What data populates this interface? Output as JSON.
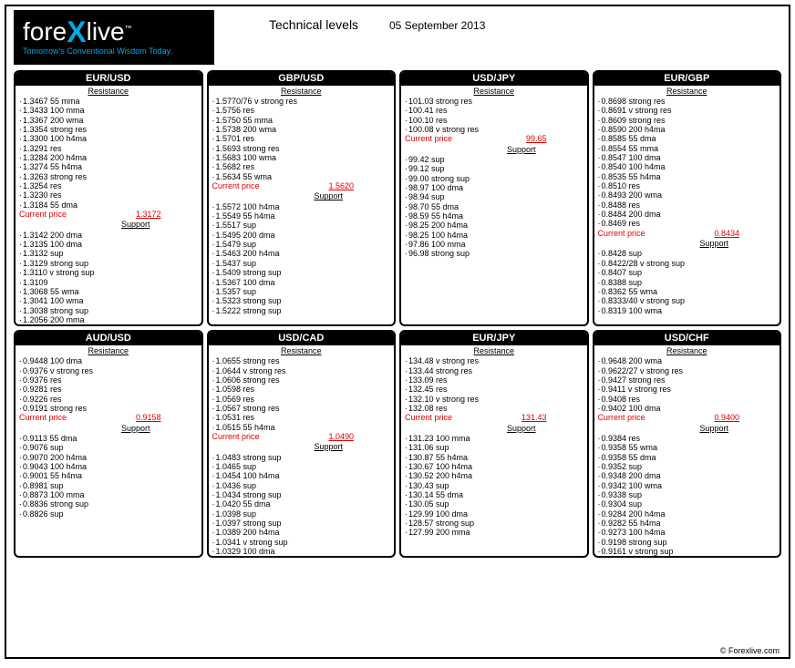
{
  "brand": {
    "name_pre": "fore",
    "name_x": "X",
    "name_post": "live",
    "tm": "™",
    "tagline": "Tomorrow's Conventional Wisdom Today."
  },
  "header": {
    "title": "Technical levels",
    "date": "05 September 2013"
  },
  "labels": {
    "resistance": "Resistance",
    "support": "Support",
    "current_price": "Current price"
  },
  "footer": "© Forexlive.com",
  "pairs": [
    {
      "symbol": "EUR/USD",
      "resistance": [
        "1.3467 55 mma",
        "1.3433 100 mma",
        "1.3367 200 wma",
        "1.3354 strong res",
        "1.3300 100 h4ma",
        "1.3291 res",
        "1.3284 200 h4ma",
        "1.3274 55 h4ma",
        "1.3263 strong res",
        "1.3254 res",
        "1.3230 res",
        "1.3184 55 dma"
      ],
      "current_price": "1.3172",
      "support": [
        "1.3142 200 dma",
        "1.3135 100 dma",
        "1.3132 sup",
        "1.3129 strong sup",
        "1.3110 v strong sup",
        "1.3109",
        "1.3068 55 wma",
        "1.3041 100 wma",
        "1.3038 strong sup",
        "1.2056 200 mma"
      ]
    },
    {
      "symbol": "GBP/USD",
      "resistance": [
        "1.5770/76 v strong res",
        "1.5756 res",
        "1.5750 55 mma",
        "1.5738 200 wma",
        "1.5701 res",
        "1.5693 strong res",
        "1.5683 100 wma",
        "1.5682 res",
        "1.5634 55 wma"
      ],
      "current_price": "1.5620",
      "support": [
        "1.5572 100 h4ma",
        "1.5549 55 h4ma",
        "1.5517 sup",
        "1.5495 200 dma",
        "1.5479 sup",
        "1.5463 200 h4ma",
        "1.5437 sup",
        "1.5409 strong sup",
        "1.5367 100 dma",
        "1.5357 sup",
        "1.5323 strong sup",
        "1.5222 strong sup"
      ]
    },
    {
      "symbol": "USD/JPY",
      "resistance": [
        "101.03 strong res",
        "100.41 res",
        "100.10 res",
        "100.08 v strong res"
      ],
      "current_price": "99.65",
      "support": [
        "99.42 sup",
        "99.12 sup",
        "99.00 strong sup",
        "98.97 100 dma",
        "98.94 sup",
        "98.70 55 dma",
        "98.59 55 h4ma",
        "98.25 200 h4ma",
        "98.25 100 h4ma",
        "97.86 100 mma",
        "96.98 strong sup"
      ]
    },
    {
      "symbol": "EUR/GBP",
      "resistance": [
        "0.8698 strong res",
        "0.8691 v strong res",
        "0.8609 strong res",
        "0.8590 200 h4ma",
        "0.8585 55 dma",
        "0.8554 55 mma",
        "0.8547 100 dma",
        "0.8540 100 h4ma",
        "0.8535 55 h4ma",
        "0.8510 res",
        "0.8493 200 wma",
        "0.8488 res",
        "0.8484 200 dma",
        "0.8469 res"
      ],
      "current_price": "0.8434",
      "support": [
        "0.8428 sup",
        "0.8422/28 v strong sup",
        "0.8407 sup",
        "0.8388 sup",
        "0.8362 55 wma",
        "0.8333/40 v strong sup",
        "0.8319 100 wma"
      ]
    },
    {
      "symbol": "AUD/USD",
      "resistance": [
        "0.9448 100 dma",
        "0.9376 v strong res",
        "0.9376 res",
        "0.9281 res",
        "0.9226 res",
        "0.9191 strong res"
      ],
      "current_price": "0.9158",
      "support": [
        "0.9113 55 dma",
        "0.9076 sup",
        "0.9070 200 h4ma",
        "0.9043 100 h4ma",
        "0.9001 55 h4ma",
        "0.8981 sup",
        "0.8873 100 mma",
        "0.8836 strong sup",
        "0.8826 sup"
      ]
    },
    {
      "symbol": "USD/CAD",
      "resistance": [
        "1.0655 strong res",
        "1.0644 v strong res",
        "1.0606 strong res",
        "1.0598 res",
        "1.0569 res",
        "1.0567 strong res",
        "1.0531 res",
        "1.0515 55 h4ma"
      ],
      "current_price": "1.0490",
      "support": [
        "1.0483 strong sup",
        "1.0465 sup",
        "1.0454 100 h4ma",
        "1.0436 sup",
        "1.0434 strong sup",
        "1.0420 55 dma",
        "1.0398 sup",
        "1.0397 strong sup",
        "1.0389 200 h4ma",
        "1.0341 v strong sup",
        "1.0329 100 dma"
      ]
    },
    {
      "symbol": "EUR/JPY",
      "resistance": [
        "134.48 v strong res",
        "133.44 strong res",
        "133.09 res",
        "132.45 res",
        "132.10 v strong res",
        "132.08 res"
      ],
      "current_price": "131.43",
      "support": [
        "131.23 100 mma",
        "131.06 sup",
        "130.87 55 h4ma",
        "130.67 100 h4ma",
        "130.52 200 h4ma",
        "130.43 sup",
        "130.14 55 dma",
        "130.05 sup",
        "129.99 100 dma",
        "128.57 strong sup",
        "127.99 200 mma"
      ]
    },
    {
      "symbol": "USD/CHF",
      "resistance": [
        "0.9648 200 wma",
        "0.9622/27 v strong res",
        "0.9427 strong res",
        "0.9411 v strong res",
        "0.9408 res",
        "0.9402 100 dma"
      ],
      "current_price": "0.9400",
      "support": [
        "0.9384 res",
        "0.9358 55 wma",
        "0.9358 55 dma",
        "0.9352 sup",
        "0.9348 200 dma",
        "0.9342 100 wma",
        "0.9338 sup",
        "0.9304 sup",
        "0.9284 200 h4ma",
        "0.9282 55 h4ma",
        "0.9273 100 h4ma",
        "0.9198 strong sup",
        "0.9161 v strong sup"
      ]
    }
  ]
}
